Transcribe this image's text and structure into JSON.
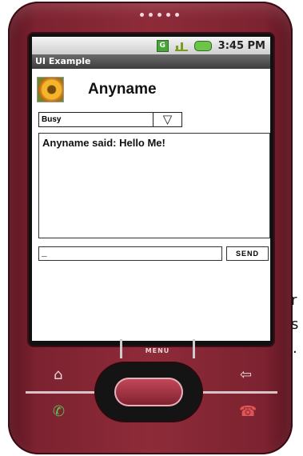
{
  "edge_text": [
    "r",
    "s",
    "."
  ],
  "status_bar": {
    "time": "3:45 PM",
    "icons": [
      "g-icon",
      "signal-icon",
      "battery-icon"
    ],
    "g_label": "G"
  },
  "app": {
    "title": "UI Example",
    "contact_name": "Anyname",
    "status_spinner": {
      "selected": "Busy",
      "arrow": "▽"
    },
    "chat_messages": [
      "Anyname said: Hello Me!"
    ],
    "message_input": {
      "value": "_",
      "placeholder": ""
    },
    "send_label": "SEND"
  },
  "hardware": {
    "menu_label": "MENU",
    "home_icon": "⌂",
    "back_icon": "⇦",
    "call_icon": "✆",
    "end_call_icon": "☎"
  },
  "colors": {
    "phone_body": "#8e2b39",
    "title_bar": "#4a4a4a",
    "status_bar": "#dcdcdc"
  }
}
